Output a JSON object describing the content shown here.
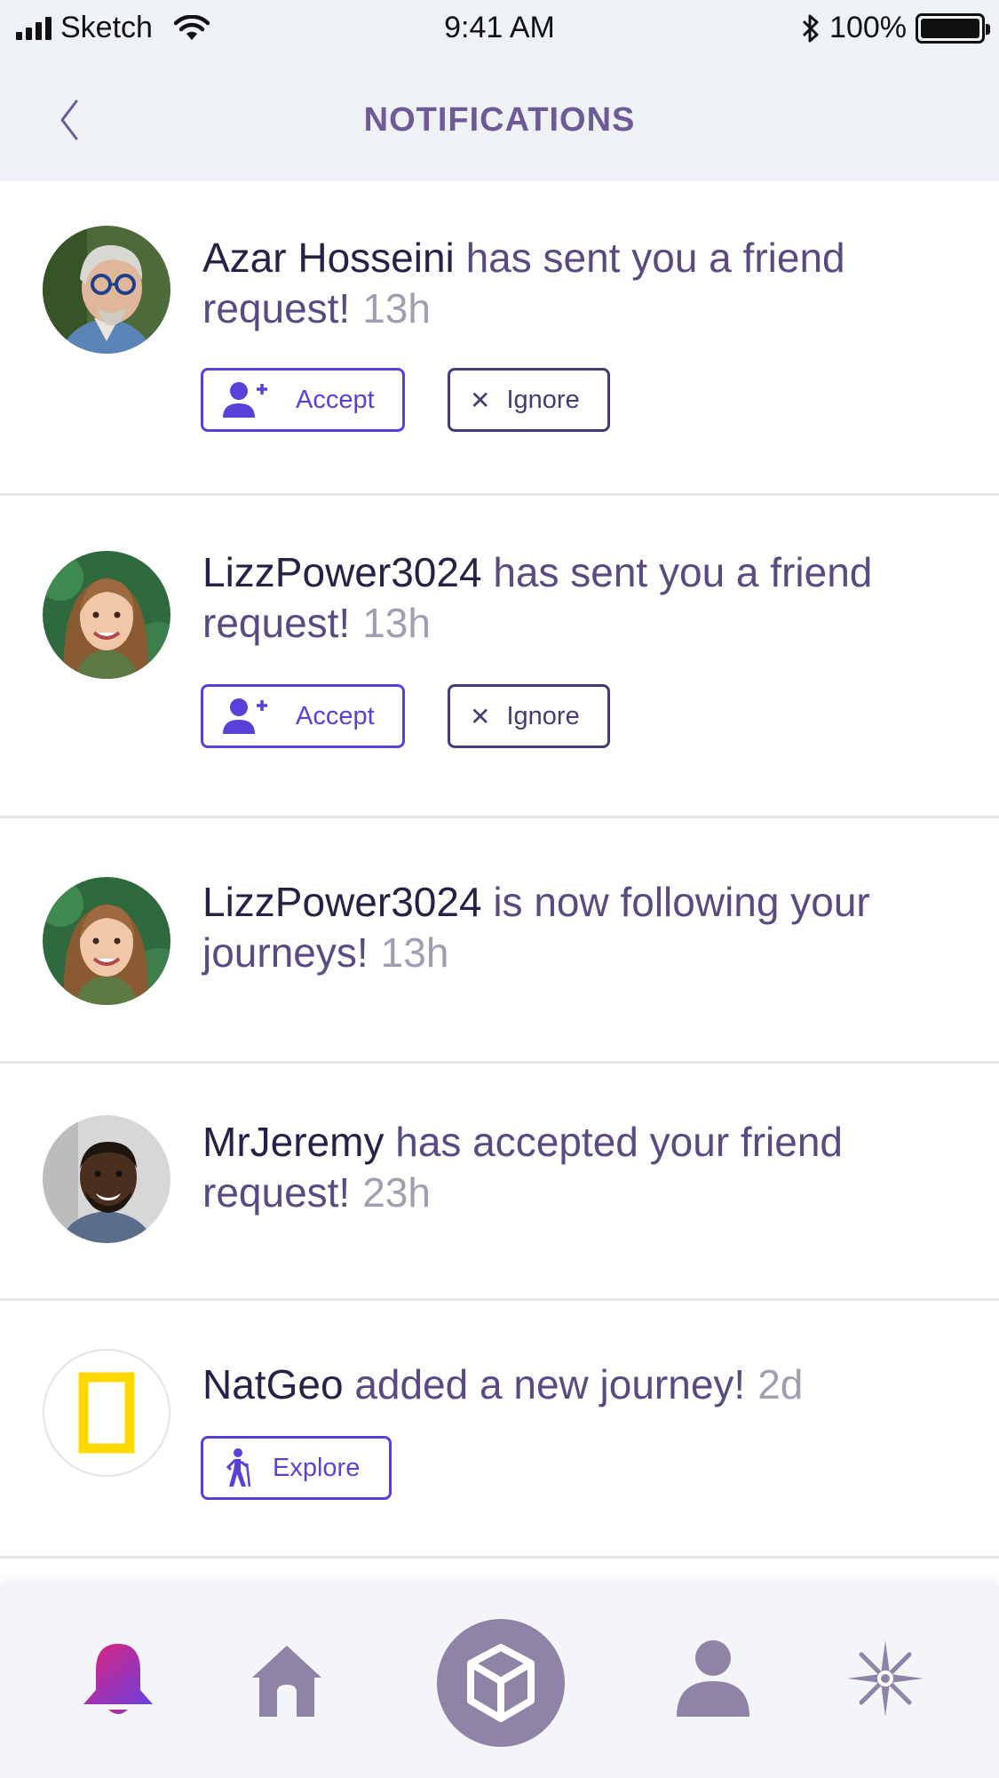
{
  "status_bar": {
    "carrier": "Sketch",
    "time": "9:41 AM",
    "battery": "100%"
  },
  "header": {
    "title": "NOTIFICATIONS",
    "back_icon": "chevron-left-icon"
  },
  "notifications": [
    {
      "name": "Azar Hosseini",
      "message": "has sent you a friend request!",
      "time": "13h",
      "accept_label": "Accept",
      "ignore_label": "Ignore"
    },
    {
      "name": "LizzPower3024",
      "message": "has sent you a friend request!",
      "time": "13h",
      "accept_label": "Accept",
      "ignore_label": "Ignore"
    },
    {
      "name": "LizzPower3024",
      "message": "is now following your journeys!",
      "time": "13h"
    },
    {
      "name": "MrJeremy",
      "message": "has accepted your friend request!",
      "time": "23h"
    },
    {
      "name": "NatGeo",
      "message": "added a new journey!",
      "time": "2d",
      "explore_label": "Explore"
    }
  ],
  "tab_bar": {
    "items": [
      "bell-icon",
      "home-icon",
      "cube-icon",
      "profile-icon",
      "compass-icon"
    ],
    "active": "bell-icon"
  },
  "colors": {
    "accent": "#5b3fd9",
    "title": "#6e5a96",
    "tab_icon": "#8f84a8",
    "natgeo_yellow": "#ffd800"
  }
}
